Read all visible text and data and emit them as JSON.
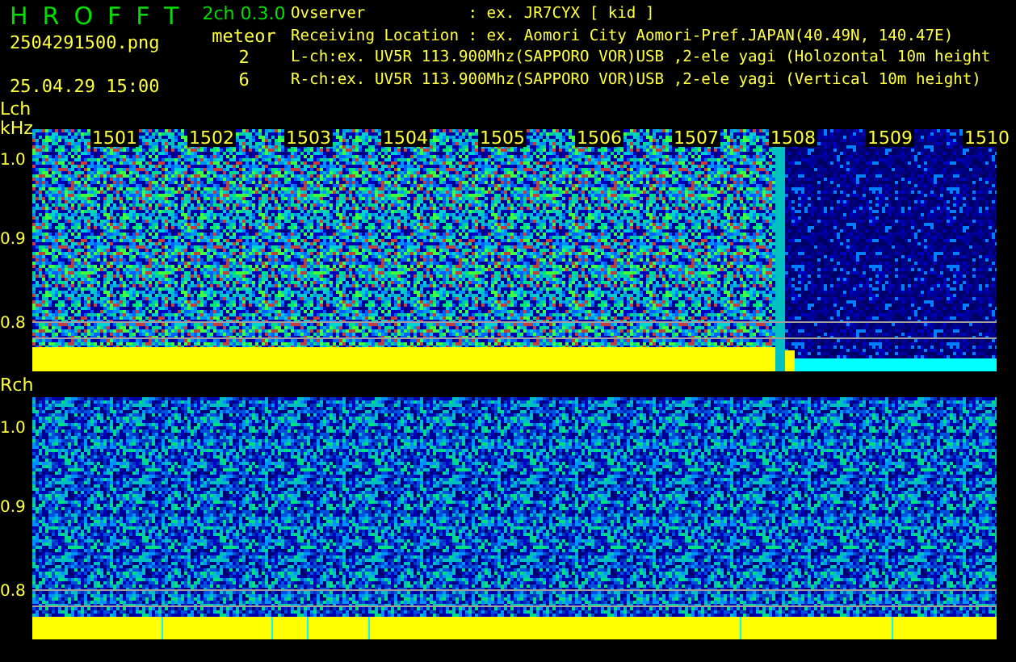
{
  "app": {
    "title": "HROFFT",
    "version": "2ch 0.3.0",
    "file": "2504291500.png",
    "datetime": "25.04.29 15:00"
  },
  "meteor": {
    "label": "meteor",
    "counts": [
      "2",
      "6"
    ]
  },
  "info": [
    "Ovserver           : ex. JR7CYX [ kid ]",
    "Receiving Location : ex. Aomori City Aomori-Pref.JAPAN(40.49N, 140.47E)",
    "L-ch:ex. UV5R 113.900Mhz(SAPPORO VOR)USB ,2-ele yagi (Holozontal 10m height",
    "R-ch:ex. UV5R 113.900Mhz(SAPPORO VOR)USB ,2-ele yagi (Vertical 10m height)"
  ],
  "channels": [
    {
      "label": "Lch",
      "unit": "kHz",
      "yticks": [
        "1.0",
        "0.9",
        "0.8"
      ],
      "time_labels": [
        "1501",
        "1502",
        "1503",
        "1504",
        "1505",
        "1506",
        "1507",
        "1508",
        "1509",
        "1510"
      ]
    },
    {
      "label": "Rch",
      "yticks": [
        "1.0",
        "0.9",
        "0.8"
      ]
    }
  ]
}
